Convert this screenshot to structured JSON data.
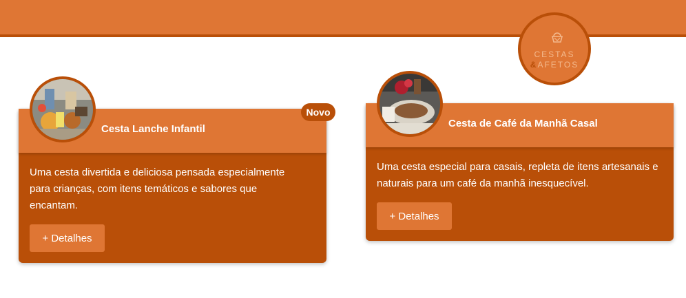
{
  "logo": {
    "line1": "CESTAS",
    "amp": "&",
    "line2": "AFETOS"
  },
  "cards": [
    {
      "title": "Cesta Lanche Infantil",
      "badge": "Novo",
      "description": "Uma cesta divertida e deliciosa pensada especialmente para crianças, com itens temáticos e sabores que encantam.",
      "button": "+ Detalhes"
    },
    {
      "title": "Cesta de Café da Manhã Casal",
      "description": "Uma cesta especial para casais, repleta de itens artesanais e naturais para um café da manhã inesquecível.",
      "button": "+ Detalhes"
    }
  ],
  "colors": {
    "primary": "#df7634",
    "dark": "#b94f08",
    "text": "#ffffff"
  }
}
